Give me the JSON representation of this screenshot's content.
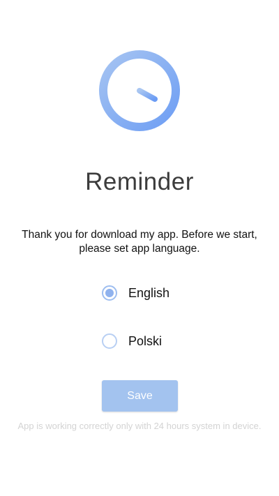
{
  "app": {
    "title": "Reminder",
    "logo_icon": "clock-icon",
    "logo_color": "#7aa6f3"
  },
  "intro": {
    "text": "Thank you for download my app. Before we start, please set app language."
  },
  "language": {
    "selected": "English",
    "options": [
      {
        "label": "English",
        "checked": true
      },
      {
        "label": "Polski",
        "checked": false
      }
    ]
  },
  "actions": {
    "save_label": "Save",
    "save_color": "#a3c3ef"
  },
  "footnote": {
    "text": "App is working correctly only with 24 hours system in device."
  }
}
